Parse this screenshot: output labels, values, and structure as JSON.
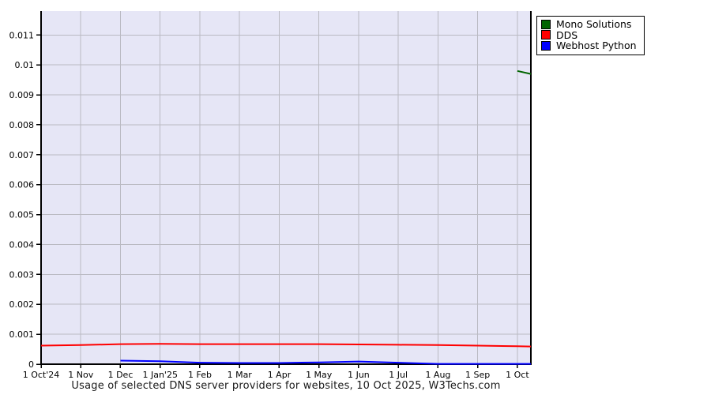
{
  "chart_data": {
    "type": "line",
    "title": "Usage of selected DNS server providers for websites, 10 Oct 2025, W3Techs.com",
    "xlabel": "",
    "ylabel": "",
    "grid": true,
    "legend_position": "top-right-outside",
    "plot_bg_color": "#e6e6f6",
    "grid_color": "#babac2",
    "axis_color": "#000000",
    "xlim": [
      0,
      12.34
    ],
    "ylim": [
      0,
      0.0118
    ],
    "x_tick_labels": [
      "1 Oct'24",
      "1 Nov",
      "1 Dec",
      "1 Jan'25",
      "1 Feb",
      "1 Mar",
      "1 Apr",
      "1 May",
      "1 Jun",
      "1 Jul",
      "1 Aug",
      "1 Sep",
      "1 Oct"
    ],
    "x_tick_positions": [
      0,
      1,
      2,
      3,
      4,
      5,
      6,
      7,
      8,
      9,
      10,
      11,
      12
    ],
    "y_tick_labels": [
      "0",
      "0.001",
      "0.002",
      "0.003",
      "0.004",
      "0.005",
      "0.006",
      "0.007",
      "0.008",
      "0.009",
      "0.01",
      "0.011"
    ],
    "y_tick_values": [
      0,
      0.001,
      0.002,
      0.003,
      0.004,
      0.005,
      0.006,
      0.007,
      0.008,
      0.009,
      0.01,
      0.011
    ],
    "x": [
      0,
      1,
      2,
      3,
      4,
      5,
      6,
      7,
      8,
      9,
      10,
      11,
      12,
      12.34
    ],
    "series": [
      {
        "name": "Mono Solutions",
        "color": "#006400",
        "values": [
          null,
          null,
          null,
          null,
          null,
          null,
          null,
          null,
          null,
          null,
          null,
          null,
          0.0098,
          0.0097
        ]
      },
      {
        "name": "DDS",
        "color": "#ff0000",
        "values": [
          0.00062,
          0.00064,
          0.00067,
          0.00068,
          0.00067,
          0.00067,
          0.00067,
          0.00067,
          0.00066,
          0.00065,
          0.00064,
          0.00062,
          0.0006,
          0.00059
        ]
      },
      {
        "name": "Webhost Python",
        "color": "#0000ff",
        "values": [
          null,
          null,
          0.00012,
          0.0001,
          5e-05,
          4e-05,
          4e-05,
          6e-05,
          9e-05,
          5e-05,
          1e-05,
          1e-05,
          1e-05,
          1e-05
        ]
      }
    ]
  }
}
